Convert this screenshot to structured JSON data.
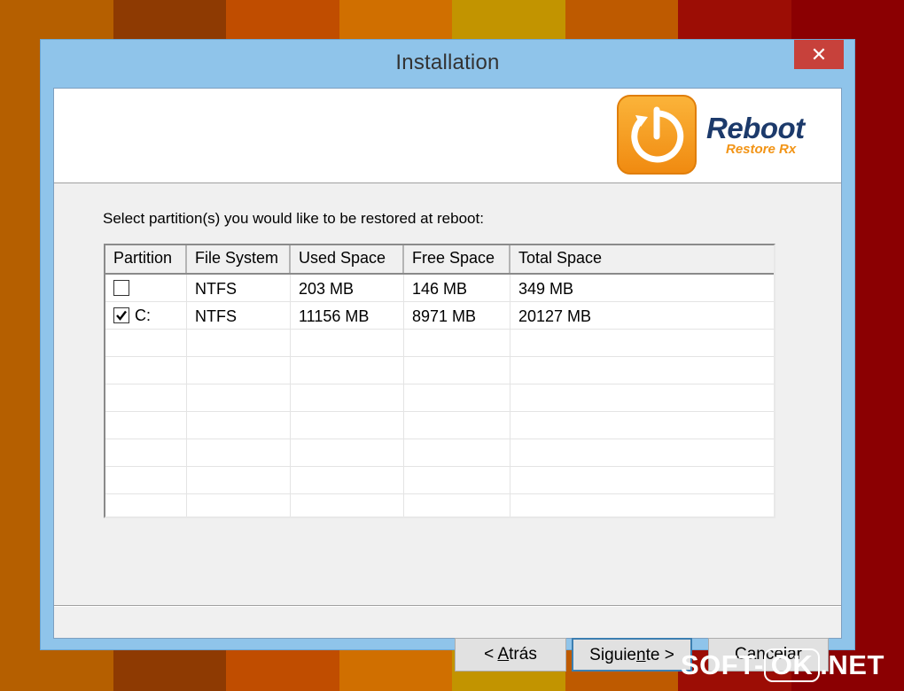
{
  "background": {
    "stripe_colors": [
      "#b55f00",
      "#8e3a02",
      "#c04d00",
      "#d06f00",
      "#c29400",
      "#be5a00",
      "#9c0d05",
      "#8b0002"
    ]
  },
  "window": {
    "title": "Installation",
    "close_label": "✕"
  },
  "logo": {
    "word": "Reboot",
    "sub": "Restore Rx",
    "colors": {
      "orange": "#f5a623",
      "navy": "#1c3a6b",
      "accent": "#f29416"
    }
  },
  "prompt": "Select partition(s) you would like to be restored at reboot:",
  "table": {
    "headers": [
      "Partition",
      "File System",
      "Used Space",
      "Free Space",
      "Total Space"
    ],
    "rows": [
      {
        "checked": false,
        "partition": "",
        "fs": "NTFS",
        "used": "203 MB",
        "free": "146 MB",
        "total": "349 MB"
      },
      {
        "checked": true,
        "partition": "C:",
        "fs": "NTFS",
        "used": "11156 MB",
        "free": "8971 MB",
        "total": "20127 MB"
      }
    ]
  },
  "buttons": {
    "back": {
      "prefix": "< ",
      "mnemonic": "A",
      "rest": "trás"
    },
    "next": {
      "before": "Siguie",
      "mnemonic": "n",
      "after": "te >"
    },
    "cancel": "Cancelar"
  },
  "watermark": {
    "left": "SOFT-",
    "box": "OK",
    "right": ".NET"
  }
}
